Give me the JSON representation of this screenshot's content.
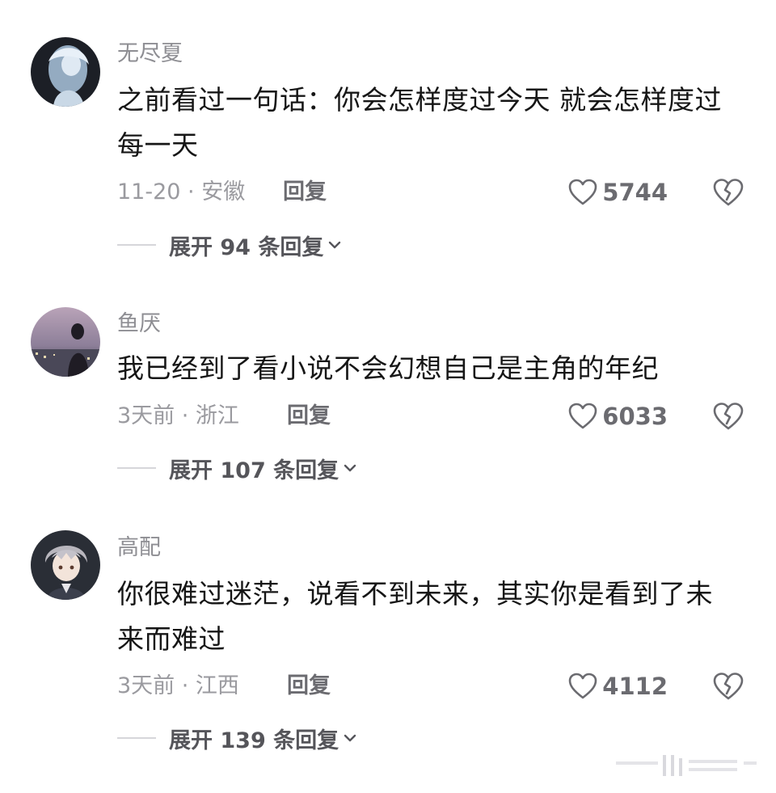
{
  "comments": [
    {
      "username": "无尽夏",
      "text": "之前看过一句话：你会怎样度过今天 就会怎样度过每一天",
      "meta": "11-20 · 安徽",
      "reply_label": "回复",
      "likes": "5744",
      "expand_label": "展开 94 条回复"
    },
    {
      "username": "鱼厌",
      "text": "我已经到了看小说不会幻想自己是主角的年纪",
      "meta": "3天前 · 浙江",
      "reply_label": "回复",
      "likes": "6033",
      "expand_label": "展开 107 条回复"
    },
    {
      "username": "高配",
      "text": "你很难过迷茫，说看不到未来，其实你是看到了未来而难过",
      "meta": "3天前 · 江西",
      "reply_label": "回复",
      "likes": "4112",
      "expand_label": "展开 139 条回复"
    }
  ],
  "icons": {
    "like": "heart-outline-icon",
    "dislike": "broken-heart-icon",
    "expand": "chevron-down-icon"
  },
  "colors": {
    "username": "#8e8e93",
    "body": "#161616",
    "meta": "#9a9a9f",
    "action": "#6b6b70"
  }
}
